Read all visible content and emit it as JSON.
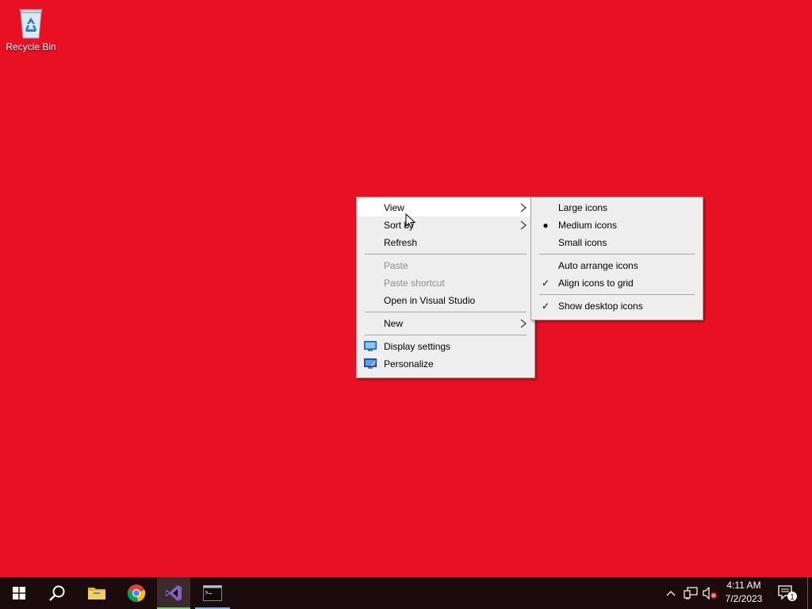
{
  "desktop": {
    "background_color": "#e81123",
    "icons": [
      {
        "label": "Recycle Bin",
        "icon": "recycle-bin-icon"
      }
    ]
  },
  "context_menu": {
    "items": [
      {
        "label": "View",
        "has_submenu": true,
        "highlighted": true
      },
      {
        "label": "Sort by",
        "has_submenu": true
      },
      {
        "label": "Refresh"
      },
      {
        "label": "Paste",
        "disabled": true
      },
      {
        "label": "Paste shortcut",
        "disabled": true
      },
      {
        "label": "Open in Visual Studio"
      },
      {
        "label": "New",
        "has_submenu": true
      },
      {
        "label": "Display settings",
        "icon": "display-settings-icon"
      },
      {
        "label": "Personalize",
        "icon": "personalize-icon"
      }
    ]
  },
  "view_submenu": {
    "items": [
      {
        "label": "Large icons"
      },
      {
        "label": "Medium icons",
        "selected_mark": "bullet"
      },
      {
        "label": "Small icons"
      },
      {
        "label": "Auto arrange icons"
      },
      {
        "label": "Align icons to grid",
        "checked": true
      },
      {
        "label": "Show desktop icons",
        "checked": true
      }
    ]
  },
  "taskbar": {
    "apps": [
      {
        "name": "Start",
        "icon": "windows-start-icon"
      },
      {
        "name": "Search",
        "icon": "search-icon"
      },
      {
        "name": "File Explorer",
        "icon": "folder-icon"
      },
      {
        "name": "Google Chrome",
        "icon": "chrome-icon"
      },
      {
        "name": "Visual Studio",
        "icon": "visual-studio-icon",
        "active": true,
        "underline_color": "#6fd16f"
      },
      {
        "name": "Command Prompt",
        "icon": "terminal-icon",
        "underline_color": "#76b9ed"
      }
    ],
    "tray": {
      "icons": [
        "chevron-up-icon",
        "network-icon",
        "volume-muted-icon"
      ],
      "time": "4:11 AM",
      "date": "7/2/2023",
      "notification_count": "1"
    }
  }
}
